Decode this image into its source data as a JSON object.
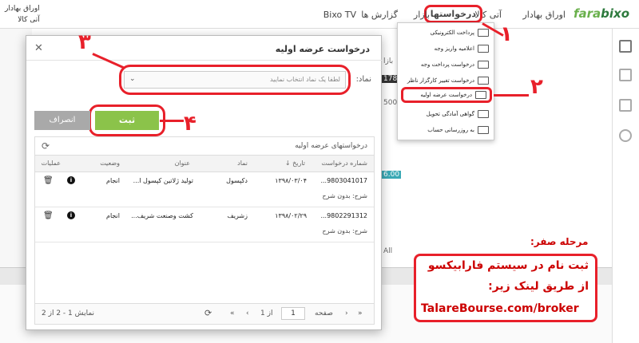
{
  "header": {
    "logo_part1": "fara",
    "logo_part2": "bixo",
    "nav": [
      "اوراق بهادار",
      "آتی کالا",
      "درخواستها",
      "بازار",
      "گزارش ها",
      "Bixo TV"
    ],
    "account_line1": "اوراق بهادار",
    "account_line2": "آتی کالا"
  },
  "dropdown": {
    "items": [
      "پرداخت الکترونیکی",
      "اعلامیه واریز وجه",
      "درخواست پرداخت وجه",
      "درخواست تغییر کارگزار ناظر",
      "درخواست عرضه اولیه",
      "گواهی آمادگی تحویل",
      "به روزرسانی حساب"
    ]
  },
  "background": {
    "side_values": [
      "بازا",
      "178.0",
      "500",
      "6.00",
      "All"
    ]
  },
  "modal": {
    "title": "درخواست عرضه اولیه",
    "close": "✕",
    "symbol_label": "نماد:",
    "symbol_placeholder": "لطفا یک نماد انتخاب نمایید",
    "submit": "ثبت",
    "cancel": "انصراف",
    "list_title": "درخواستهای عرضه اولیه",
    "columns": [
      "شماره درخواست",
      "تاریخ",
      "نماد",
      "عنوان",
      "وضعیت",
      "عملیات"
    ],
    "rows": [
      {
        "number": "9803041017...",
        "date": "۱۳۹۸/۰۳/۰۴",
        "symbol": "دکپسول",
        "title": "تولید ژلاتین کپسول ا...",
        "status": "انجام",
        "desc": "شرح: بدون شرح"
      },
      {
        "number": "9802291312...",
        "date": "۱۳۹۸/۰۲/۲۹",
        "symbol": "زشریف",
        "title": "کشت وصنعت شریف...",
        "status": "انجام",
        "desc": "شرح: بدون شرح"
      }
    ],
    "pager": {
      "page_label": "صفحه",
      "page_value": "1",
      "of_label": "از 1",
      "summary": "نمایش 1 - 2 از 2"
    }
  },
  "annotations": {
    "n1": "۱",
    "n2": "۲",
    "n3": "۳",
    "n4": "۴",
    "note_title": "مرحله صفر:",
    "note_line1": "ثبت نام در سیستم فارابیکسو",
    "note_line2": "از طریق لینک زیر:",
    "note_url": "TalareBourse.com/broker"
  },
  "colors": {
    "accent": "#e8202a",
    "submit": "#8bc34a",
    "cancel": "#a9a9a9",
    "brand": "#2d7a3d"
  }
}
